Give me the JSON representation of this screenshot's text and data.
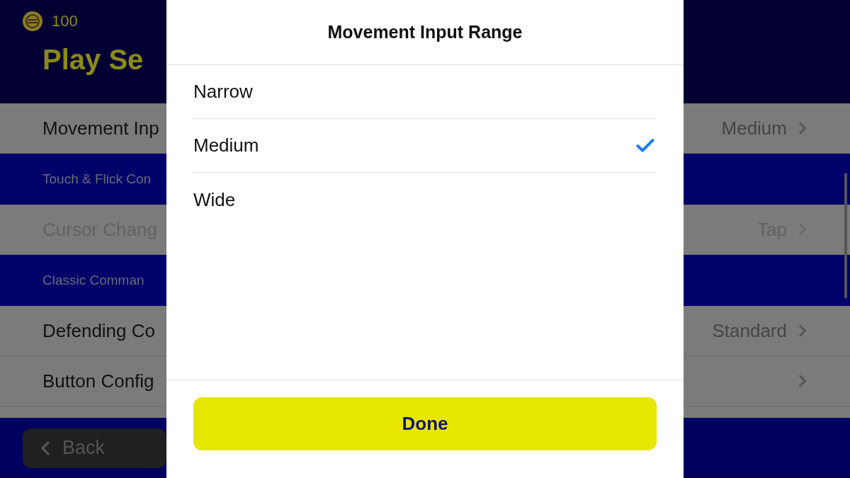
{
  "header": {
    "coins": "100",
    "title": "Play Se"
  },
  "settings": [
    {
      "kind": "row",
      "label": "Movement Inp",
      "value": "Medium",
      "disabled": false
    },
    {
      "kind": "section",
      "label": "Touch & Flick Con"
    },
    {
      "kind": "row",
      "label": "Cursor Chang",
      "value": "Tap",
      "disabled": true
    },
    {
      "kind": "section",
      "label": "Classic Comman"
    },
    {
      "kind": "row",
      "label": "Defending Co",
      "value": "Standard",
      "disabled": false
    },
    {
      "kind": "row",
      "label": "Button Config",
      "disabled": false
    }
  ],
  "back_button": "Back",
  "dialog": {
    "title": "Movement Input Range",
    "options": [
      {
        "label": "Narrow",
        "selected": false
      },
      {
        "label": "Medium",
        "selected": true
      },
      {
        "label": "Wide",
        "selected": false
      }
    ],
    "done_button": "Done"
  }
}
